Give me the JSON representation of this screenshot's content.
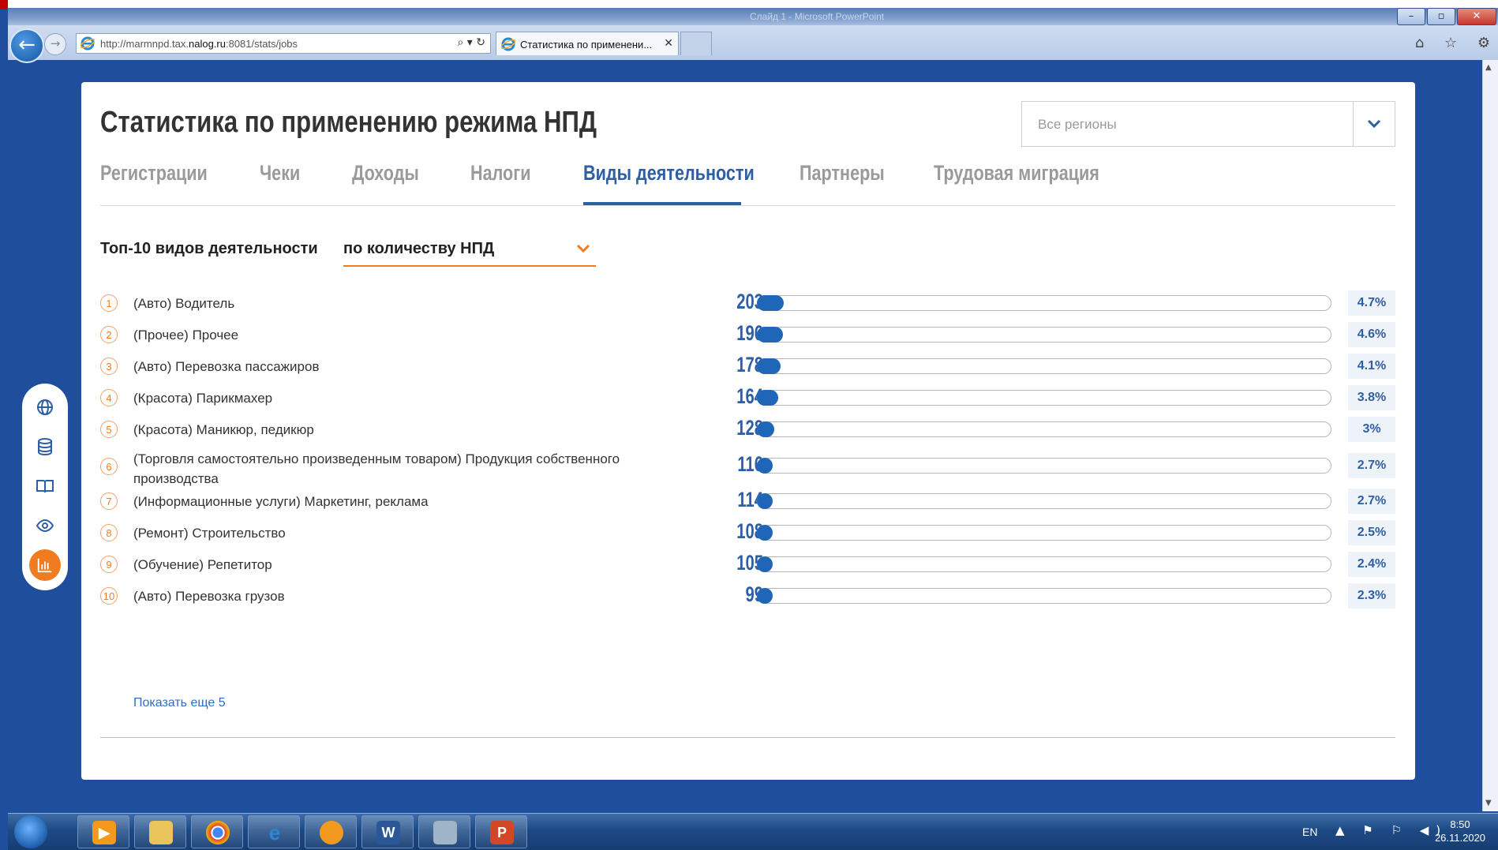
{
  "browser": {
    "window_title_ghost": "Слайд 1 - Microsoft PowerPoint",
    "window_buttons": [
      "–",
      "▫",
      "✕"
    ],
    "url_prefix": "http://marmnpd.tax.",
    "url_domain": "nalog.ru",
    "url_suffix": ":8081/stats/jobs",
    "address_controls": "⌕ ▾ ↻",
    "tab_title": "Статистика по применени...",
    "tab_close": "✕",
    "right_icons": "⌂ ☆ ⚙"
  },
  "page": {
    "title": "Статистика по применению режима НПД",
    "region_placeholder": "Все регионы",
    "tabs": [
      {
        "label": "Регистрации",
        "active": false
      },
      {
        "label": "Чеки",
        "active": false
      },
      {
        "label": "Доходы",
        "active": false
      },
      {
        "label": "Налоги",
        "active": false
      },
      {
        "label": "Виды деятельности",
        "active": true
      },
      {
        "label": "Партнеры",
        "active": false
      },
      {
        "label": "Трудовая миграция",
        "active": false
      }
    ],
    "section_title": "Топ-10 видов деятельности",
    "sort_value": "по количеству НПД",
    "show_more": "Показать еще 5"
  },
  "chart_data": {
    "type": "bar",
    "title": "Топ-10 видов деятельности",
    "categories": [
      "(Авто) Водитель",
      "(Прочее) Прочее",
      "(Авто) Перевозка пассажиров",
      "(Красота) Парикмахер",
      "(Красота) Маникюр, педикюр",
      "(Торговля самостоятельно произведенным товаром) Продукция собственного производства",
      "(Информационные услуги) Маркетинг, реклама",
      "(Ремонт) Строительство",
      "(Обучение) Репетитор",
      "(Авто) Перевозка грузов"
    ],
    "values": [
      203,
      196,
      178,
      164,
      128,
      116,
      114,
      108,
      105,
      99
    ],
    "percents": [
      "4.7%",
      "4.6%",
      "4.1%",
      "3.8%",
      "3%",
      "2.7%",
      "2.7%",
      "2.5%",
      "2.4%",
      "2.3%"
    ],
    "shares": [
      0.047,
      0.046,
      0.041,
      0.038,
      0.03,
      0.027,
      0.027,
      0.025,
      0.024,
      0.023
    ],
    "ranks": [
      "1",
      "2",
      "3",
      "4",
      "5",
      "6",
      "7",
      "8",
      "9",
      "10"
    ]
  },
  "side_menu": {
    "icons": [
      "globe-icon",
      "database-icon",
      "book-icon",
      "eye-icon",
      "bar-chart-icon"
    ],
    "active": "bar-chart-icon"
  },
  "taskbar": {
    "apps": [
      "media-player-icon",
      "file-explorer-icon",
      "chrome-icon",
      "internet-explorer-icon",
      "app-icon",
      "word-icon",
      "teacher-app-icon",
      "powerpoint-icon"
    ],
    "language": "EN",
    "tray_icons": "▲ ⚑ ⚐ ◀)",
    "time": "8:50",
    "date": "26.11.2020"
  },
  "colors": {
    "accent": "#2e5ea3",
    "bar": "#2066b8",
    "orange": "#f07c22",
    "background": "#1f4e9c"
  }
}
